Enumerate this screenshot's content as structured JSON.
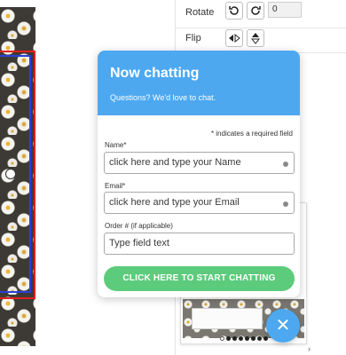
{
  "properties": {
    "rotate": {
      "label": "Rotate",
      "rotate_left_icon": "rotate-ccw-icon",
      "rotate_right_icon": "rotate-cw-icon",
      "value": "0"
    },
    "flip": {
      "label": "Flip",
      "flip_horizontal_icon": "flip-horizontal-icon",
      "flip_vertical_icon": "flip-vertical-icon"
    }
  },
  "chat": {
    "title": "Now chatting",
    "subtitle": "Questions? We'd love to chat.",
    "required_note": "* indicates a required field",
    "fields": {
      "name": {
        "label": "Name*",
        "placeholder": "click here and type your Name"
      },
      "email": {
        "label": "Email*",
        "placeholder": "click here and type your Email"
      },
      "order": {
        "label": "Order # (if applicable)",
        "placeholder": "Type field text"
      }
    },
    "start_button": "CLICK HERE TO START CHATTING",
    "close_icon": "close-icon"
  },
  "colors": {
    "chat_header": "#4da8f0",
    "start_button": "#5ccb7c",
    "selection_red": "#e0201a",
    "selection_blue": "#2a3fd8"
  },
  "thumbnail_pager": {
    "count": 8,
    "active_index": 0
  }
}
